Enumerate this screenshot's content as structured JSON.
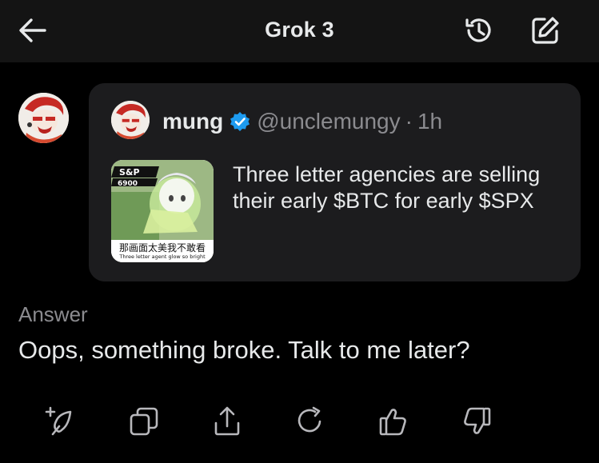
{
  "header": {
    "title": "Grok 3"
  },
  "tweet": {
    "author_name": "mung",
    "handle": "@unclemungy",
    "separator": "·",
    "time": "1h",
    "text": "Three letter agencies are selling their early $BTC for early $SPX",
    "media": {
      "caption_cn": "那画面太美我不敢看",
      "caption_en": "Three letter agent glow so bright"
    }
  },
  "answer": {
    "label": "Answer",
    "text": "Oops, something broke. Talk to me later?"
  },
  "icons": {
    "back": "arrow-left-icon",
    "history": "history-icon",
    "compose": "compose-icon",
    "verified": "verified-badge-icon",
    "actions": [
      "new-thread-icon",
      "copy-icon",
      "share-icon",
      "regenerate-icon",
      "thumbs-up-icon",
      "thumbs-down-icon"
    ]
  },
  "colors": {
    "background": "#000000",
    "header": "#141414",
    "card": "#1c1c1e",
    "text_primary": "#e7e9ea",
    "text_secondary": "#8b8b8f",
    "verified": "#1d9bf0"
  }
}
